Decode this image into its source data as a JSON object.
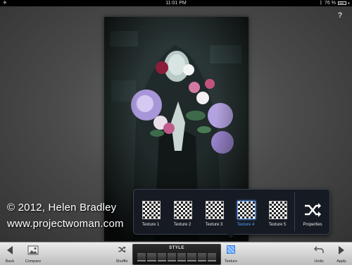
{
  "status_bar": {
    "time": "11:01 PM",
    "battery": "76 %",
    "battery_level": 0.76
  },
  "help_label": "?",
  "watermark": {
    "line1": "© 2012, Helen Bradley",
    "line2": "www.projectwoman.com"
  },
  "texture_popup": {
    "items": [
      {
        "label": "Texture 1",
        "selected": false
      },
      {
        "label": "Texture 2",
        "selected": false
      },
      {
        "label": "Texture 3",
        "selected": false
      },
      {
        "label": "Texture 4",
        "selected": true
      },
      {
        "label": "Texture 5",
        "selected": false
      }
    ],
    "properties_label": "Properties"
  },
  "toolbar": {
    "back": "Back",
    "compare": "Compare",
    "shuffle": "Shuffle",
    "style": "STYLE",
    "texture": "Texture",
    "undo": "Undo",
    "apply": "Apply"
  },
  "colors": {
    "selected_accent": "#4ea2ff",
    "toolbar_bg": "#d6d6d6",
    "popup_bg": "#161a22"
  }
}
